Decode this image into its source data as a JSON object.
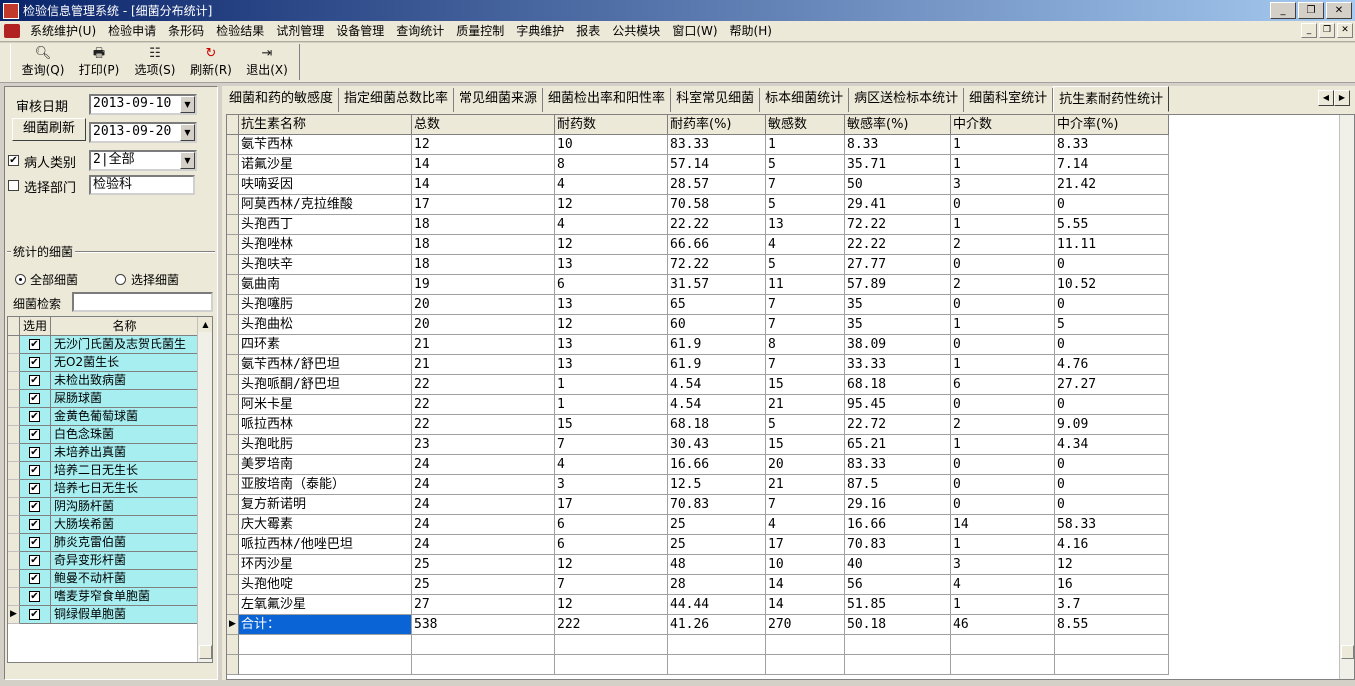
{
  "window": {
    "title": "检验信息管理系统 - [细菌分布统计]"
  },
  "menu": [
    "系统维护(U)",
    "检验申请",
    "条形码",
    "检验结果",
    "试剂管理",
    "设备管理",
    "查询统计",
    "质量控制",
    "字典维护",
    "报表",
    "公共模块",
    "窗口(W)",
    "帮助(H)"
  ],
  "toolbar": {
    "query": "查询(Q)",
    "print": "打印(P)",
    "options": "选项(S)",
    "refresh": "刷新(R)",
    "exit": "退出(X)"
  },
  "filters": {
    "audit_date_label": "审核日期",
    "date_from": "2013-09-10",
    "refresh_label": "细菌刷新",
    "date_to": "2013-09-20",
    "patient_type_label": "病人类别",
    "patient_type_value": "2|全部",
    "dept_label": "选择部门",
    "dept_value": "检验科",
    "group_label": "统计的细菌",
    "radio_all": "全部细菌",
    "radio_select": "选择细菌",
    "search_label": "细菌检索",
    "search_value": ""
  },
  "bacteria_grid": {
    "headers": [
      "选用",
      "名称"
    ],
    "rows": [
      "无沙门氏菌及志贺氏菌生",
      "无O2菌生长",
      "未检出致病菌",
      "屎肠球菌",
      "金黄色葡萄球菌",
      "白色念珠菌",
      "未培养出真菌",
      "培养二日无生长",
      "培养七日无生长",
      "阴沟肠杆菌",
      "大肠埃希菌",
      "肺炎克雷伯菌",
      "奇异变形杆菌",
      "鲍曼不动杆菌",
      "嗜麦芽窄食单胞菌",
      "铜绿假单胞菌"
    ]
  },
  "tabs": [
    "细菌和药的敏感度",
    "指定细菌总数比率",
    "常见细菌来源",
    "细菌检出率和阳性率",
    "科室常见细菌",
    "标本细菌统计",
    "病区送检标本统计",
    "细菌科室统计",
    "抗生素耐药性统计"
  ],
  "result_grid": {
    "headers": [
      "抗生素名称",
      "总数",
      "耐药数",
      "耐药率(%)",
      "敏感数",
      "敏感率(%)",
      "中介数",
      "中介率(%)"
    ],
    "rows": [
      [
        "氨苄西林",
        "12",
        "10",
        "83.33",
        "1",
        "8.33",
        "1",
        "8.33"
      ],
      [
        "诺氟沙星",
        "14",
        "8",
        "57.14",
        "5",
        "35.71",
        "1",
        "7.14"
      ],
      [
        "呋喃妥因",
        "14",
        "4",
        "28.57",
        "7",
        "50",
        "3",
        "21.42"
      ],
      [
        "阿莫西林/克拉维酸",
        "17",
        "12",
        "70.58",
        "5",
        "29.41",
        "0",
        "0"
      ],
      [
        "头孢西丁",
        "18",
        "4",
        "22.22",
        "13",
        "72.22",
        "1",
        "5.55"
      ],
      [
        "头孢唑林",
        "18",
        "12",
        "66.66",
        "4",
        "22.22",
        "2",
        "11.11"
      ],
      [
        "头孢呋辛",
        "18",
        "13",
        "72.22",
        "5",
        "27.77",
        "0",
        "0"
      ],
      [
        "氨曲南",
        "19",
        "6",
        "31.57",
        "11",
        "57.89",
        "2",
        "10.52"
      ],
      [
        "头孢噻肟",
        "20",
        "13",
        "65",
        "7",
        "35",
        "0",
        "0"
      ],
      [
        "头孢曲松",
        "20",
        "12",
        "60",
        "7",
        "35",
        "1",
        "5"
      ],
      [
        "四环素",
        "21",
        "13",
        "61.9",
        "8",
        "38.09",
        "0",
        "0"
      ],
      [
        "氨苄西林/舒巴坦",
        "21",
        "13",
        "61.9",
        "7",
        "33.33",
        "1",
        "4.76"
      ],
      [
        "头孢哌酮/舒巴坦",
        "22",
        "1",
        "4.54",
        "15",
        "68.18",
        "6",
        "27.27"
      ],
      [
        "阿米卡星",
        "22",
        "1",
        "4.54",
        "21",
        "95.45",
        "0",
        "0"
      ],
      [
        "哌拉西林",
        "22",
        "15",
        "68.18",
        "5",
        "22.72",
        "2",
        "9.09"
      ],
      [
        "头孢吡肟",
        "23",
        "7",
        "30.43",
        "15",
        "65.21",
        "1",
        "4.34"
      ],
      [
        "美罗培南",
        "24",
        "4",
        "16.66",
        "20",
        "83.33",
        "0",
        "0"
      ],
      [
        "亚胺培南（泰能）",
        "24",
        "3",
        "12.5",
        "21",
        "87.5",
        "0",
        "0"
      ],
      [
        "复方新诺明",
        "24",
        "17",
        "70.83",
        "7",
        "29.16",
        "0",
        "0"
      ],
      [
        "庆大霉素",
        "24",
        "6",
        "25",
        "4",
        "16.66",
        "14",
        "58.33"
      ],
      [
        "哌拉西林/他唑巴坦",
        "24",
        "6",
        "25",
        "17",
        "70.83",
        "1",
        "4.16"
      ],
      [
        "环丙沙星",
        "25",
        "12",
        "48",
        "10",
        "40",
        "3",
        "12"
      ],
      [
        "头孢他啶",
        "25",
        "7",
        "28",
        "14",
        "56",
        "4",
        "16"
      ],
      [
        "左氧氟沙星",
        "27",
        "12",
        "44.44",
        "14",
        "51.85",
        "1",
        "3.7"
      ],
      [
        "合计：",
        "538",
        "222",
        "41.26",
        "270",
        "50.18",
        "46",
        "8.55"
      ]
    ]
  }
}
